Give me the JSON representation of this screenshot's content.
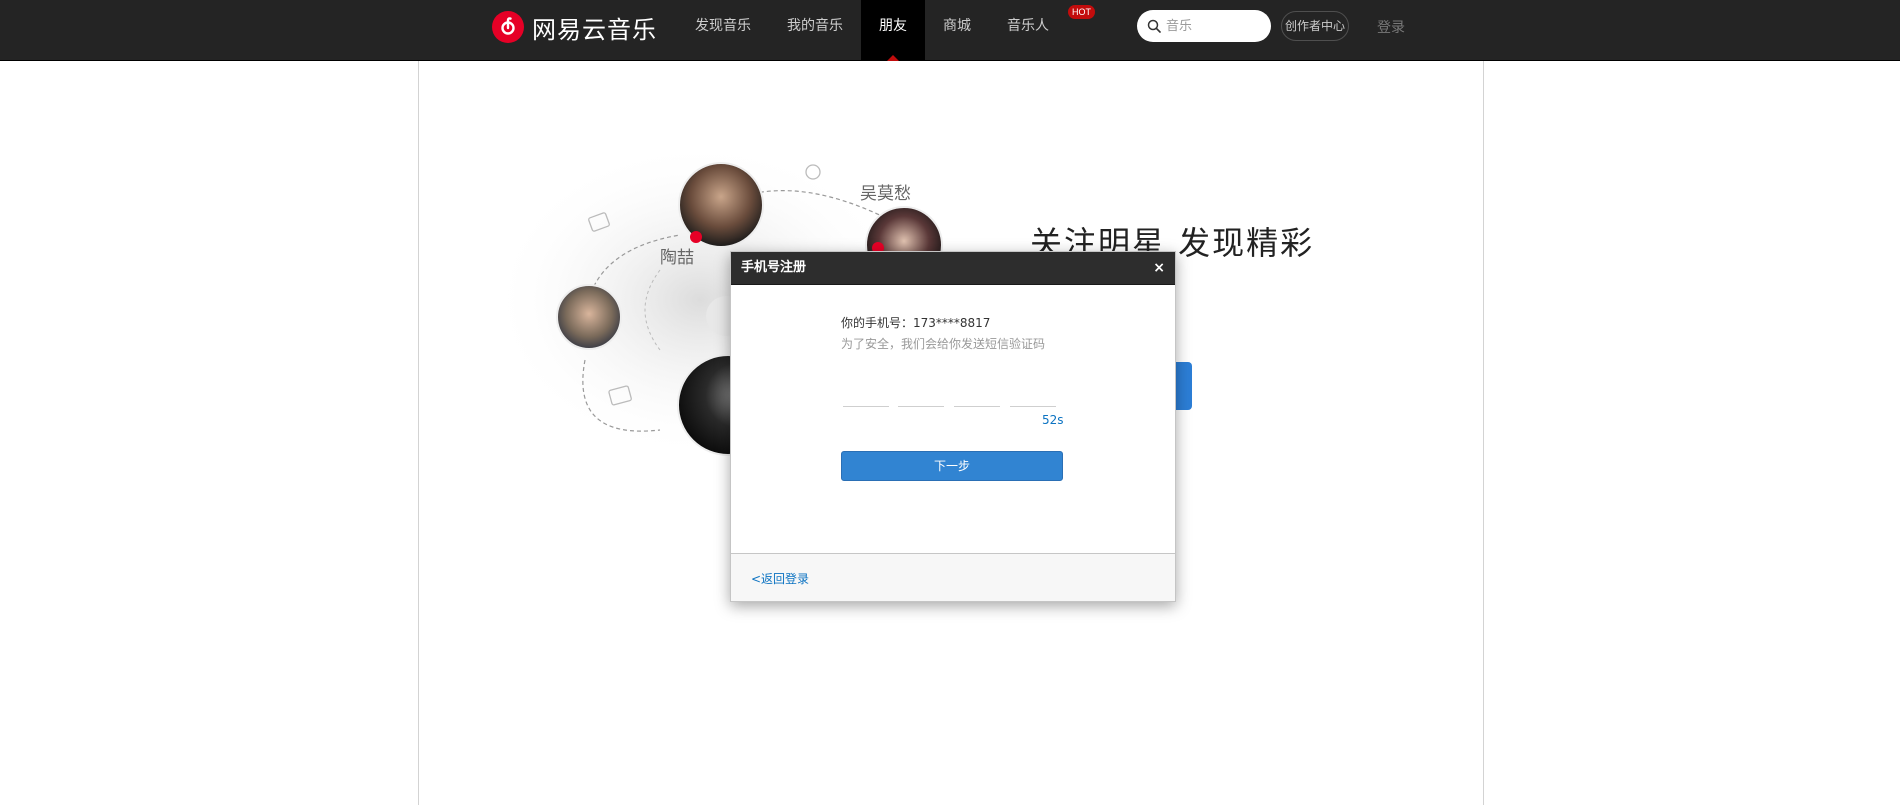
{
  "brand": {
    "name": "网易云音乐",
    "accent": "#e60026"
  },
  "nav": {
    "items": [
      {
        "label": "发现音乐"
      },
      {
        "label": "我的音乐"
      },
      {
        "label": "朋友"
      },
      {
        "label": "商城"
      },
      {
        "label": "音乐人",
        "badge": "HOT"
      }
    ],
    "active": "朋友"
  },
  "search": {
    "placeholder": "音乐"
  },
  "header": {
    "creator_label": "创作者中心",
    "login_label": "登录"
  },
  "hero": {
    "title": "关注明星 发现精彩",
    "stars": [
      "吴莫愁",
      "陶喆"
    ]
  },
  "modal": {
    "title": "手机号注册",
    "close_symbol": "×",
    "phone_text": "你的手机号：173****8817",
    "tip_text": "为了安全，我们会给你发送短信验证码",
    "countdown": "52s",
    "next_label": "下一步",
    "back_label": "<返回登录"
  }
}
